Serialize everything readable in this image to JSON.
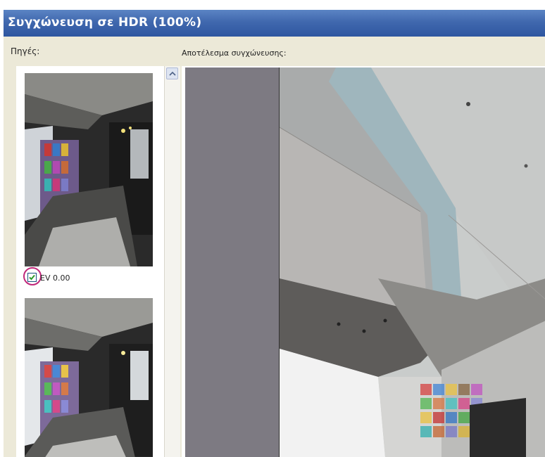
{
  "window": {
    "title": "Συγχώνευση σε HDR (100%)"
  },
  "sources": {
    "label": "Πηγές:",
    "thumbnails": [
      {
        "checked": true,
        "ev_label": "EV 0.00"
      },
      {
        "checked": null,
        "ev_label": ""
      }
    ]
  },
  "result": {
    "label": "Αποτέλεσμα συγχώνευσης:"
  },
  "colors": {
    "titlebar": "#3b62a8",
    "highlight_ring": "#c0287a",
    "checkmark": "#2a9b2a",
    "preview_margin": "#7d7a82"
  },
  "icons": {
    "scroll_up": "chevron-up-icon",
    "checkbox_mark": "checkmark-icon"
  }
}
